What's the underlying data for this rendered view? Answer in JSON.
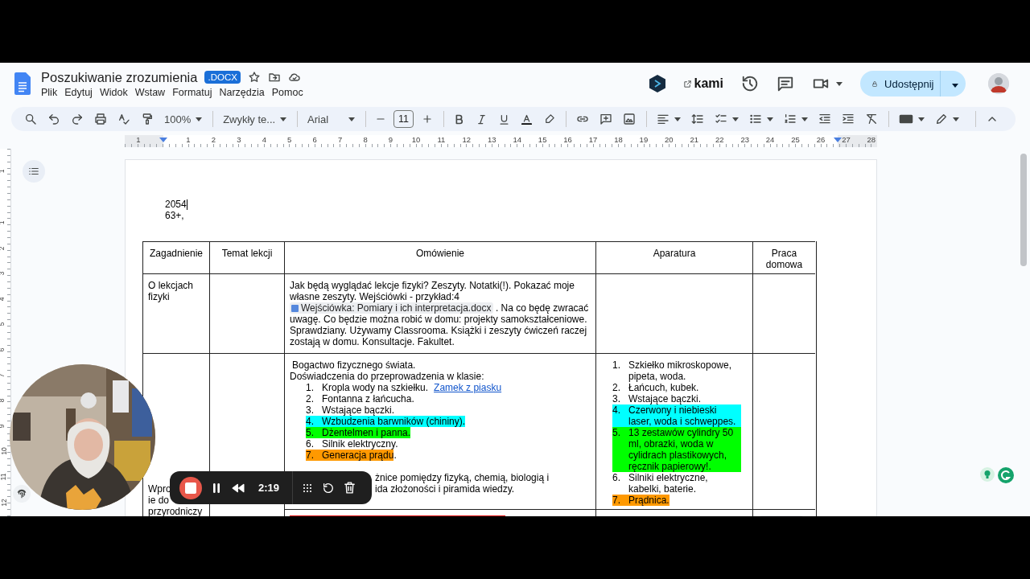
{
  "document": {
    "title": "Poszukiwanie zrozumienia",
    "badge": ".DOCX"
  },
  "menu": [
    "Plik",
    "Edytuj",
    "Widok",
    "Wstaw",
    "Formatuj",
    "Narzędzia",
    "Pomoc"
  ],
  "header_actions": {
    "kami": "kami",
    "share": "Udostępnij"
  },
  "toolbar": {
    "zoom": "100%",
    "style": "Zwykły te...",
    "font": "Arial",
    "font_size": "11"
  },
  "ruler": {
    "horizontal": [
      "1",
      "1",
      "2",
      "3",
      "4",
      "5",
      "6",
      "7",
      "8",
      "9",
      "10",
      "11",
      "12",
      "13",
      "14",
      "15",
      "16",
      "17",
      "18",
      "19",
      "20",
      "21",
      "22",
      "23",
      "24",
      "25",
      "26",
      "27",
      "28"
    ],
    "vertical": [
      "1",
      "1",
      "2",
      "3",
      "4",
      "5",
      "6",
      "7",
      "8",
      "9",
      "10",
      "11",
      "12"
    ]
  },
  "page": {
    "lines": [
      "2054",
      "63+,"
    ],
    "table": {
      "columns": [
        "Zagadnienie",
        "Temat lekcji",
        "Omówienie",
        "Aparatura",
        "Praca domowa"
      ],
      "rows": [
        {
          "topic": "O lekcjach fizyki",
          "discussion": {
            "before": "Jak będą wyglądać lekcje fizyki? Zeszyty. Notatki(!). Pokazać moje własne zeszyty. Wejściówki - przykład:4",
            "chip": "Wejściówka: Pomiary i ich interpretacja.docx",
            "after": ". Na co będę zwracać uwagę. Co będzie można robić w domu: projekty samokształceniowe. Sprawdziany. Używamy Classrooma. Książki i zeszyty ćwiczeń raczej zostają w domu. Konsultacje. Fakultet."
          }
        },
        {
          "topic_fragments": [
            "Wpro",
            "ie do",
            "przyrodniczy"
          ],
          "discussion": {
            "intro": [
              "Bogactwo fizycznego świata.",
              "Doświadczenia do przeprowadzenia w klasie:"
            ],
            "list": [
              {
                "number": "1.",
                "text": "Kropla wody na szkiełku.",
                "link": "Zamek z piasku"
              },
              {
                "number": "2.",
                "text": "Fontanna z łańcucha."
              },
              {
                "number": "3.",
                "text": "Wstające bączki."
              },
              {
                "number": "4.",
                "text": "Wzbudzenia barwników (chininy).",
                "color": "#00ffff"
              },
              {
                "number": "5.",
                "text": "Dżentelmen i panna.",
                "color": "#00ff00"
              },
              {
                "number": "6.",
                "text": "Silnik elektryczny."
              },
              {
                "number": "7.",
                "text": "Generacja prądu",
                "color": "#ff9900",
                "trailing": "."
              }
            ],
            "fragments": [
              "żnice pomiędzy fizyką, chemią, biologią i",
              "ida złożoności i piramida wiedzy."
            ]
          },
          "apparatus": [
            {
              "number": "1.",
              "text": "Szkiełko mikroskopowe, pipeta, woda."
            },
            {
              "number": "2.",
              "text": "Łańcuch, kubek."
            },
            {
              "number": "3.",
              "text": "Wstające bączki."
            },
            {
              "number": "4.",
              "text": "Czerwony i niebieski laser, woda i schweppes.",
              "color": "#00ffff"
            },
            {
              "number": "5.",
              "text": "13 zestawów cylindry 50 ml, obrazki, woda w cylidrach plastikowych, ręcznik papierowy!.",
              "color": "#00ff00"
            },
            {
              "number": "6.",
              "text": "Silniki elektryczne, kabelki, baterie."
            },
            {
              "number": "7.",
              "text": "Prądnica.",
              "color": "#ff9900"
            }
          ]
        }
      ]
    }
  },
  "recorder": {
    "time": "2:19"
  }
}
